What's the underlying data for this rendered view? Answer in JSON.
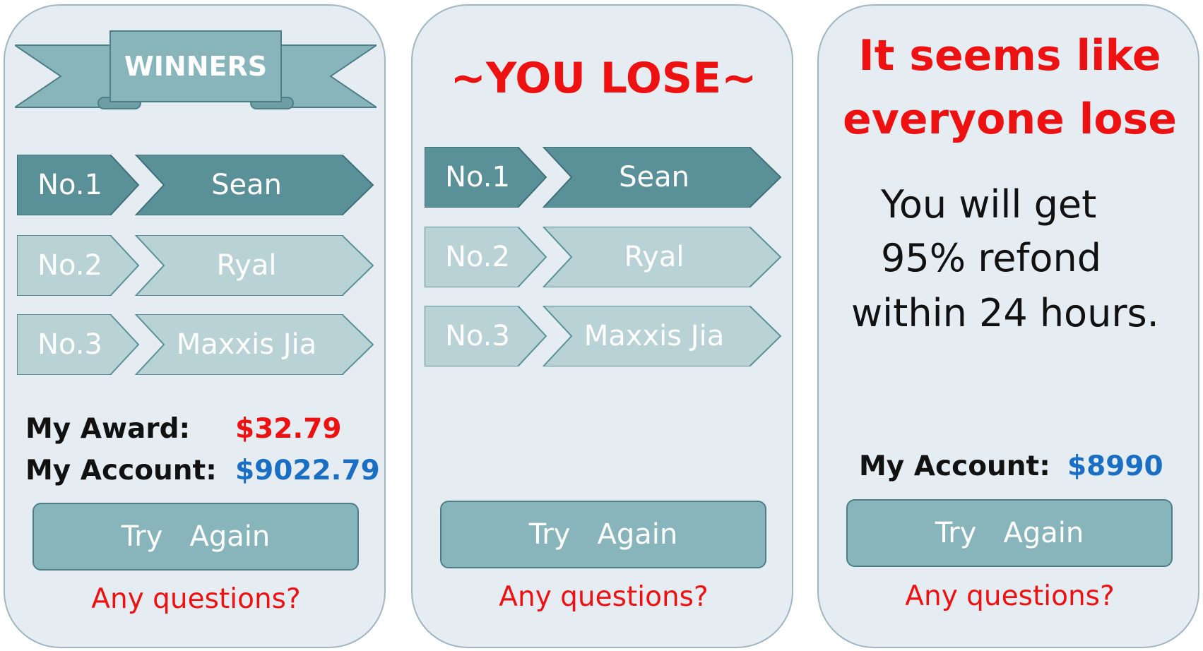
{
  "colors": {
    "panel_bg": "#e6edf2",
    "rank_dark": "#5a9199",
    "rank_light": "#b8d2d6",
    "ribbon": "#87b5bb",
    "red": "#ee1111",
    "blue": "#1a6fc4"
  },
  "winner_panel": {
    "banner": "WINNERS",
    "rankings": [
      {
        "rank": "No.1",
        "name": "Sean"
      },
      {
        "rank": "No.2",
        "name": "Ryal"
      },
      {
        "rank": "No.3",
        "name": "Maxxis Jia"
      }
    ],
    "award_label": "My  Award:",
    "award_value": "$32.79",
    "account_label": "My  Account:",
    "account_value": "$9022.79",
    "try_again": "Try   Again",
    "questions": "Any questions?"
  },
  "lose_panel": {
    "title": "~YOU LOSE~",
    "rankings": [
      {
        "rank": "No.1",
        "name": "Sean"
      },
      {
        "rank": "No.2",
        "name": "Ryal"
      },
      {
        "rank": "No.3",
        "name": "Maxxis Jia"
      }
    ],
    "try_again": "Try   Again",
    "questions": "Any questions?"
  },
  "refund_panel": {
    "title_line1": "It seems like",
    "title_line2": "everyone lose",
    "message_line1": "You will get",
    "message_line2": "95% refond",
    "message_line3": "within 24 hours.",
    "account_label": "My  Account:",
    "account_value": "$8990",
    "try_again": "Try   Again",
    "questions": "Any questions?"
  }
}
